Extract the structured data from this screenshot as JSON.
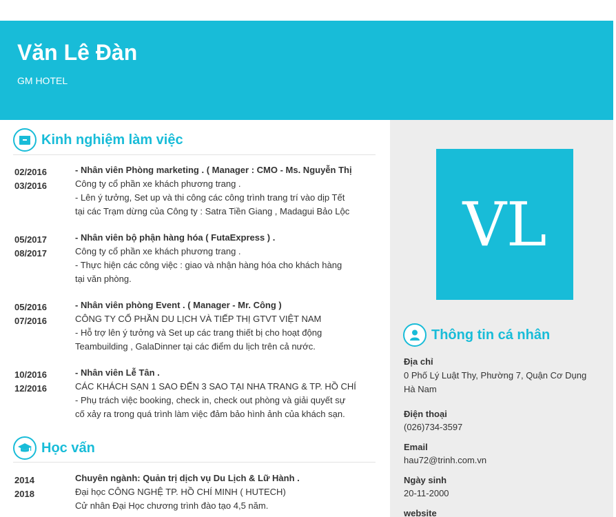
{
  "header": {
    "name": "Văn Lê Đàn",
    "company": "GM HOTEL"
  },
  "avatar": {
    "initials": "VL"
  },
  "sections": {
    "experience": {
      "title": "Kinh nghiệm làm việc",
      "icon": "briefcase-icon"
    },
    "education": {
      "title": "Học vấn",
      "icon": "graduation-cap-icon"
    },
    "personal": {
      "title": "Thông tin cá nhân",
      "icon": "user-icon"
    }
  },
  "experience": [
    {
      "start": "02/2016",
      "end": "03/2016",
      "role": "- Nhân viên Phòng marketing . ( Manager :  CMO - Ms. Nguyễn Thị",
      "company": "Công ty cổ phần xe khách phương trang .",
      "desc1": "- Lên ý tưởng, Set up và thi công các công trình trang trí vào dịp Tết",
      "desc2": "tại các Trạm dừng của Công ty : Satra Tiền Giang , Madagui Bảo Lộc"
    },
    {
      "start": "05/2017",
      "end": "08/2017",
      "role": "- Nhân viên bộ phận hàng hóa ( FutaExpress ) .",
      "company": "Công ty cổ phần xe khách phương trang .",
      "desc1": "- Thực hiện các công việc : giao và nhận hàng hóa cho khách hàng",
      "desc2": "tại văn phòng."
    },
    {
      "start": "05/2016",
      "end": "07/2016",
      "role": "- Nhân viên phòng Event . ( Manager - Mr. Công )",
      "company": "CÔNG TY CỔ PHẦN DU LỊCH VÀ TIẾP THỊ GTVT VIỆT NAM",
      "desc1": "- Hỗ trợ lên ý tưởng và Set up các trang thiết bị cho hoạt động",
      "desc2": "Teambuilding , GalaDinner tại các điểm du lịch trên cả nước."
    },
    {
      "start": "10/2016",
      "end": "12/2016",
      "role": "- Nhân viên Lễ Tân .",
      "company": "CÁC KHÁCH SẠN 1 SAO ĐẾN 3 SAO TẠI NHA TRANG & TP. HỒ CHÍ",
      "desc1": "- Phụ trách việc booking, check in, check out phòng và giải quyết sự",
      "desc2": "cố xảy ra trong quá trình làm việc đảm bảo hình ảnh của khách sạn."
    }
  ],
  "education": [
    {
      "start": "2014",
      "end": "2018",
      "major": "Chuyên ngành: Quản trị dịch vụ Du Lịch & Lữ Hành .",
      "school": "Đại học CÔNG NGHỆ TP. HỒ CHÍ MINH ( HUTECH)",
      "degree": "Cử nhân Đại Học chương trình đào tạo 4,5 năm."
    }
  ],
  "personal": {
    "address_label": "Địa chỉ",
    "address_line1": "0 Phố Lý Luật Thy, Phường 7, Quận Cơ Dụng",
    "address_line2": "Hà Nam",
    "phone_label": "Điện thoại",
    "phone": "(026)734-3597",
    "email_label": "Email",
    "email": "hau72@trinh.com.vn",
    "dob_label": "Ngày sinh",
    "dob": "20-11-2000",
    "website_label": "website"
  },
  "colors": {
    "accent": "#18bcd8",
    "sidebar_bg": "#ededed",
    "text": "#333333"
  }
}
